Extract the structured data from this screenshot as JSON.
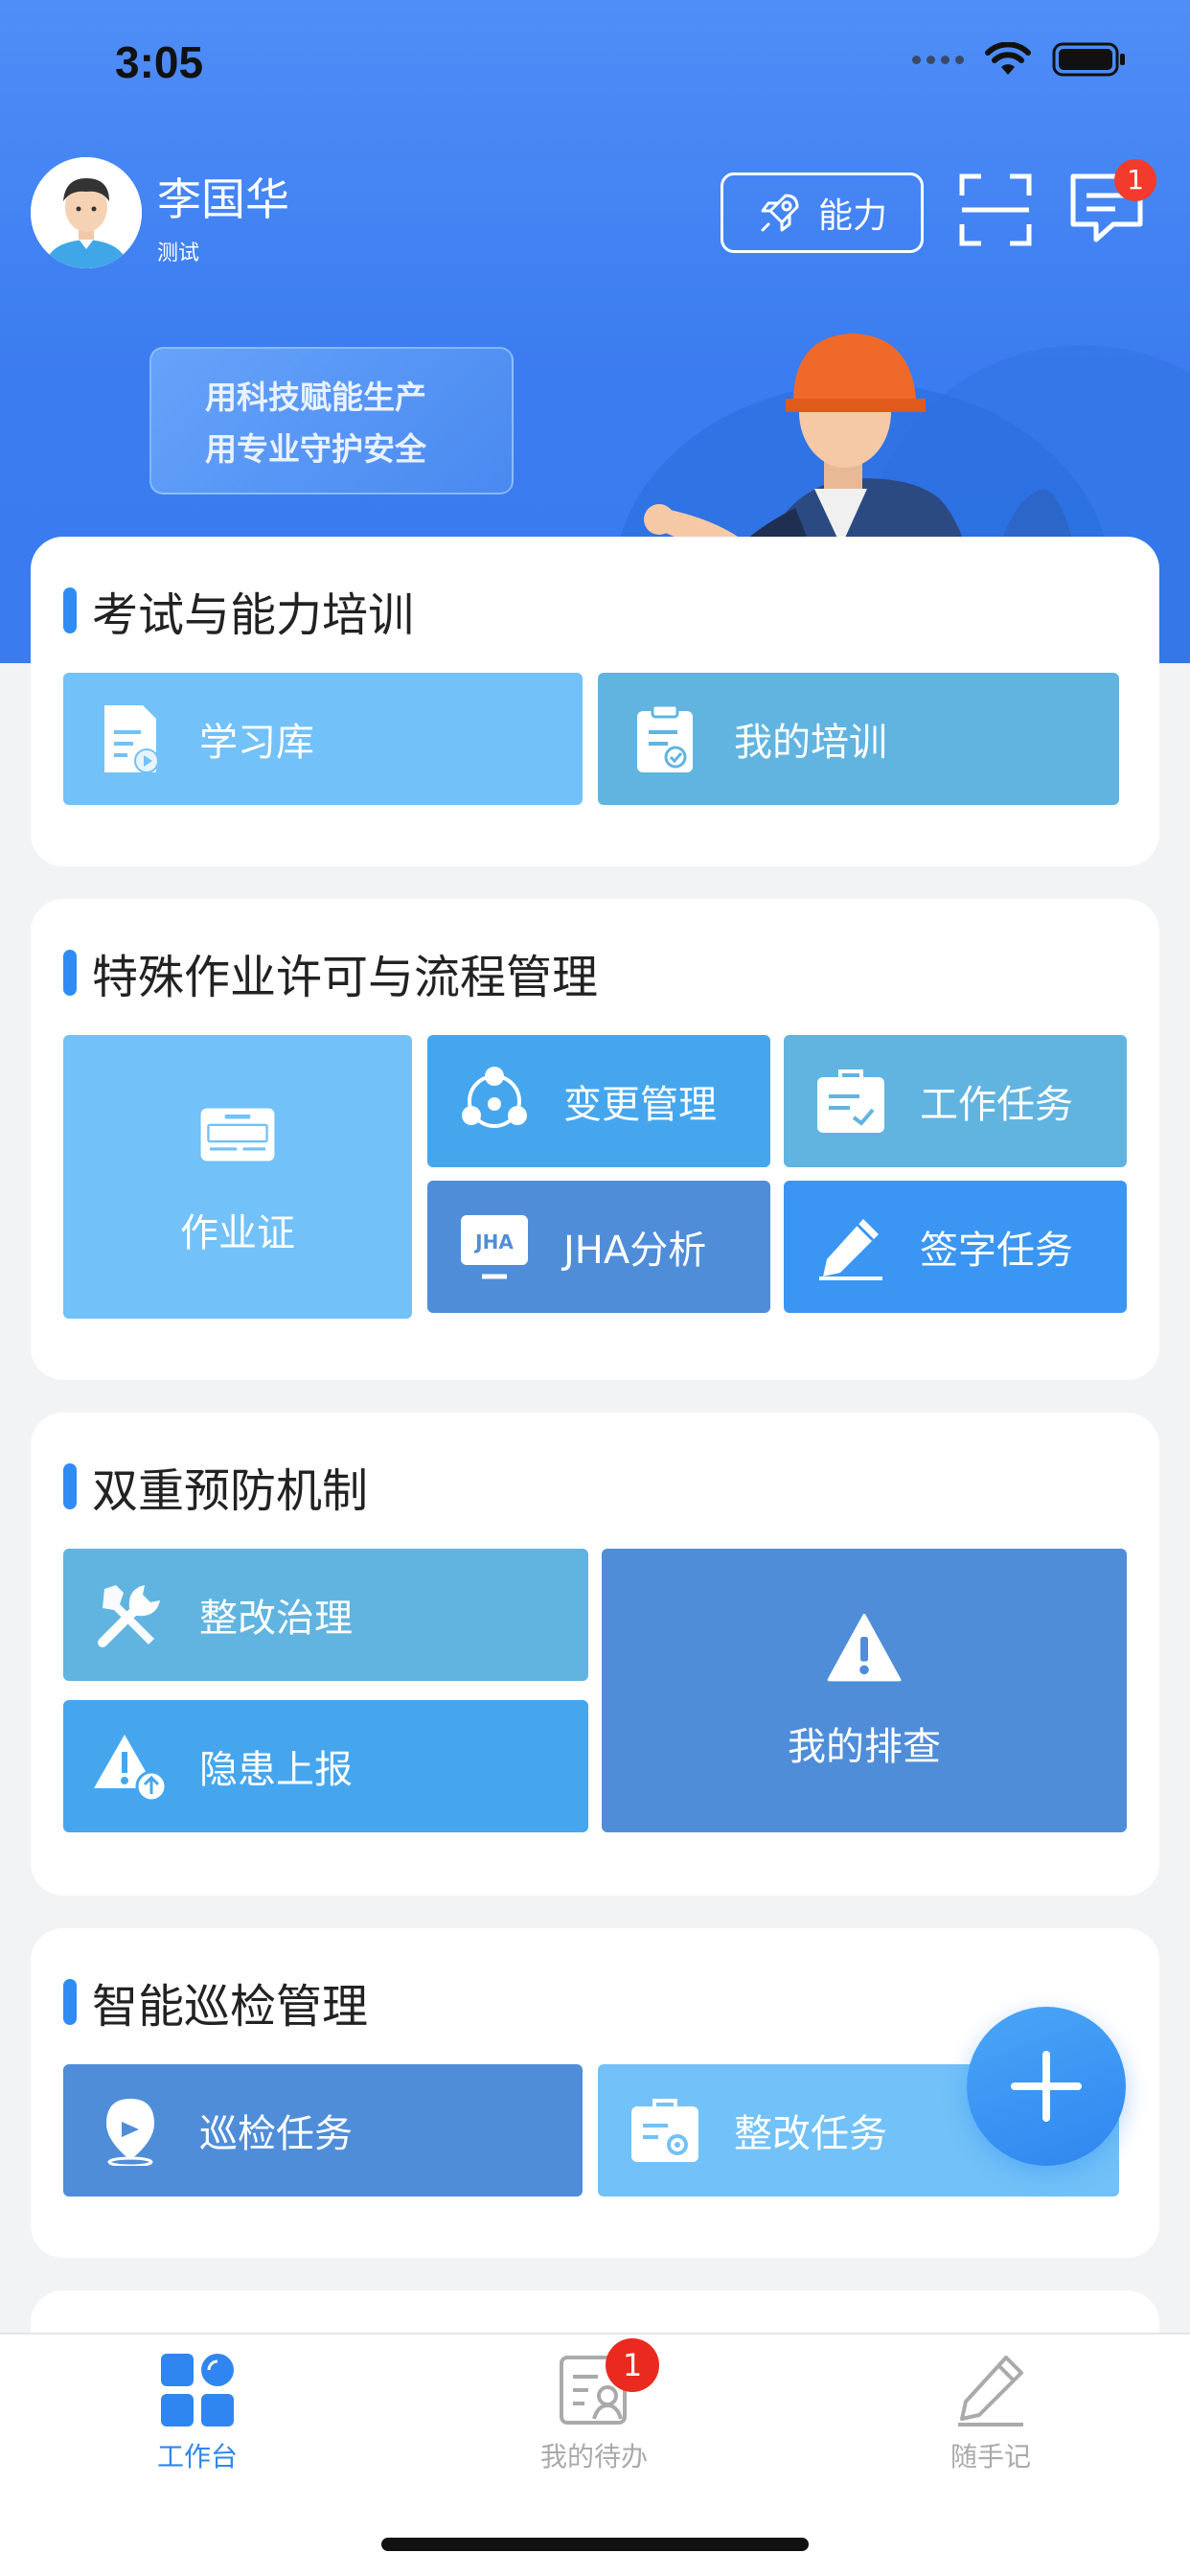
{
  "status_bar": {
    "time": "3:05"
  },
  "header": {
    "user_name": "李国华",
    "user_role": "测试",
    "ability_label": "能力",
    "message_badge": "1",
    "slogan_line1": "用科技赋能生产",
    "slogan_line2": "用专业守护安全"
  },
  "sections": {
    "training": {
      "title": "考试与能力培训",
      "items": [
        "学习库",
        "我的培训"
      ]
    },
    "permit": {
      "title": "特殊作业许可与流程管理",
      "items": [
        "作业证",
        "变更管理",
        "工作任务",
        "JHA分析",
        "签字任务"
      ]
    },
    "prevention": {
      "title": "双重预防机制",
      "items": [
        "整改治理",
        "隐患上报",
        "我的排查"
      ]
    },
    "patrol": {
      "title": "智能巡检管理",
      "items": [
        "巡检任务",
        "整改任务"
      ]
    }
  },
  "tabbar": {
    "tabs": [
      "工作台",
      "我的待办",
      "随手记"
    ],
    "todo_badge": "1",
    "active_color": "#2f86f0"
  },
  "colors": {
    "header_blue": "#3a7bef",
    "accent": "#2f8cf5",
    "badge_red": "#f23b2c"
  }
}
